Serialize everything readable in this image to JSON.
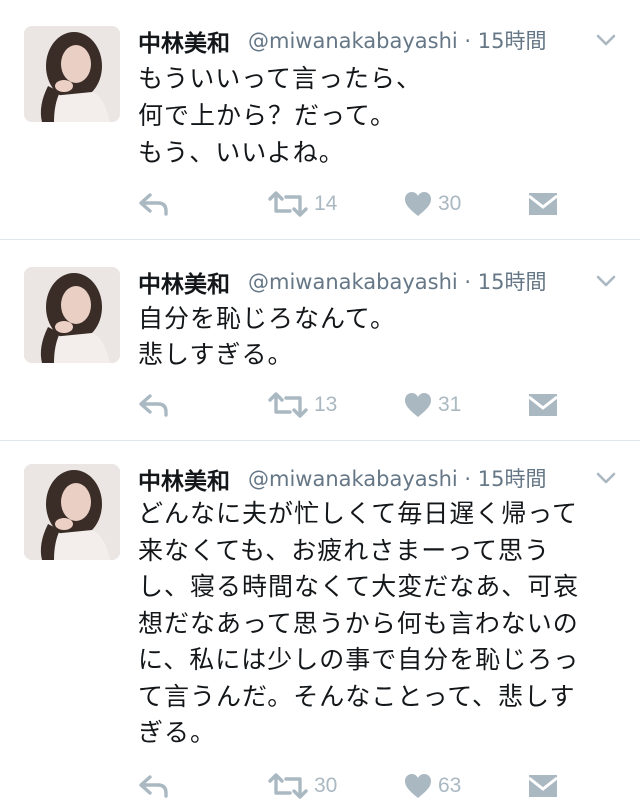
{
  "colors": {
    "icon_gray": "#aab8c2",
    "meta_gray": "#657786",
    "divider": "#e1e8ed"
  },
  "tweets": [
    {
      "display_name": "中林美和",
      "handle": "@miwanakabayashi · 15時間",
      "text": "もういいって言ったら、\n何で上から？だって。\nもう、いいよね。",
      "retweets": "14",
      "likes": "30"
    },
    {
      "display_name": "中林美和",
      "handle": "@miwanakabayashi · 15時間",
      "text": "自分を恥じろなんて。\n悲しすぎる。",
      "retweets": "13",
      "likes": "31"
    },
    {
      "display_name": "中林美和",
      "handle": "@miwanakabayashi · 15時間",
      "text": "どんなに夫が忙しくて毎日遅く帰って\n来なくても、お疲れさまーって思う\nし、寝る時間なくて大変だなあ、可哀\n想だなあって思うから何も言わないの\nに、私には少しの事で自分を恥じろっ\nて言うんだ。そんなことって、悲しす\nぎる。",
      "retweets": "30",
      "likes": "63"
    }
  ],
  "icons": {
    "avatar": "avatar-photo",
    "more": "chevron-down-icon",
    "reply": "reply-icon",
    "retweet": "retweet-icon",
    "like": "heart-icon",
    "message": "envelope-icon"
  }
}
